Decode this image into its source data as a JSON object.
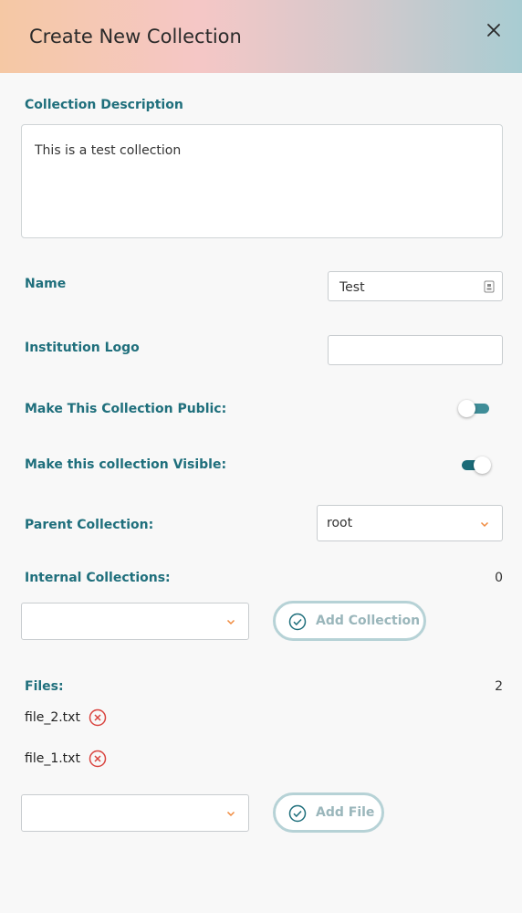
{
  "dialog": {
    "title": "Create New Collection"
  },
  "form": {
    "description_label": "Collection Description",
    "description_value": "This is a test collection",
    "name_label": "Name",
    "name_value": "Test",
    "logo_label": "Institution Logo",
    "logo_value": "",
    "public_label": "Make This Collection Public:",
    "public_on": false,
    "visible_label": "Make this collection Visible:",
    "visible_on": true,
    "parent_label": "Parent Collection:",
    "parent_value": "root",
    "internal_label": "Internal Collections:",
    "internal_count": "0",
    "internal_select_value": "",
    "add_collection_label": "Add Collection",
    "files_label": "Files:",
    "files_count": "2",
    "files": [
      {
        "name": "file_2.txt"
      },
      {
        "name": "file_1.txt"
      }
    ],
    "file_select_value": "",
    "add_file_label": "Add File"
  },
  "colors": {
    "accent": "#1f6f7c",
    "remove": "#d9443f",
    "button_border": "#b6d2d6",
    "chevron": "#f08a3e"
  }
}
